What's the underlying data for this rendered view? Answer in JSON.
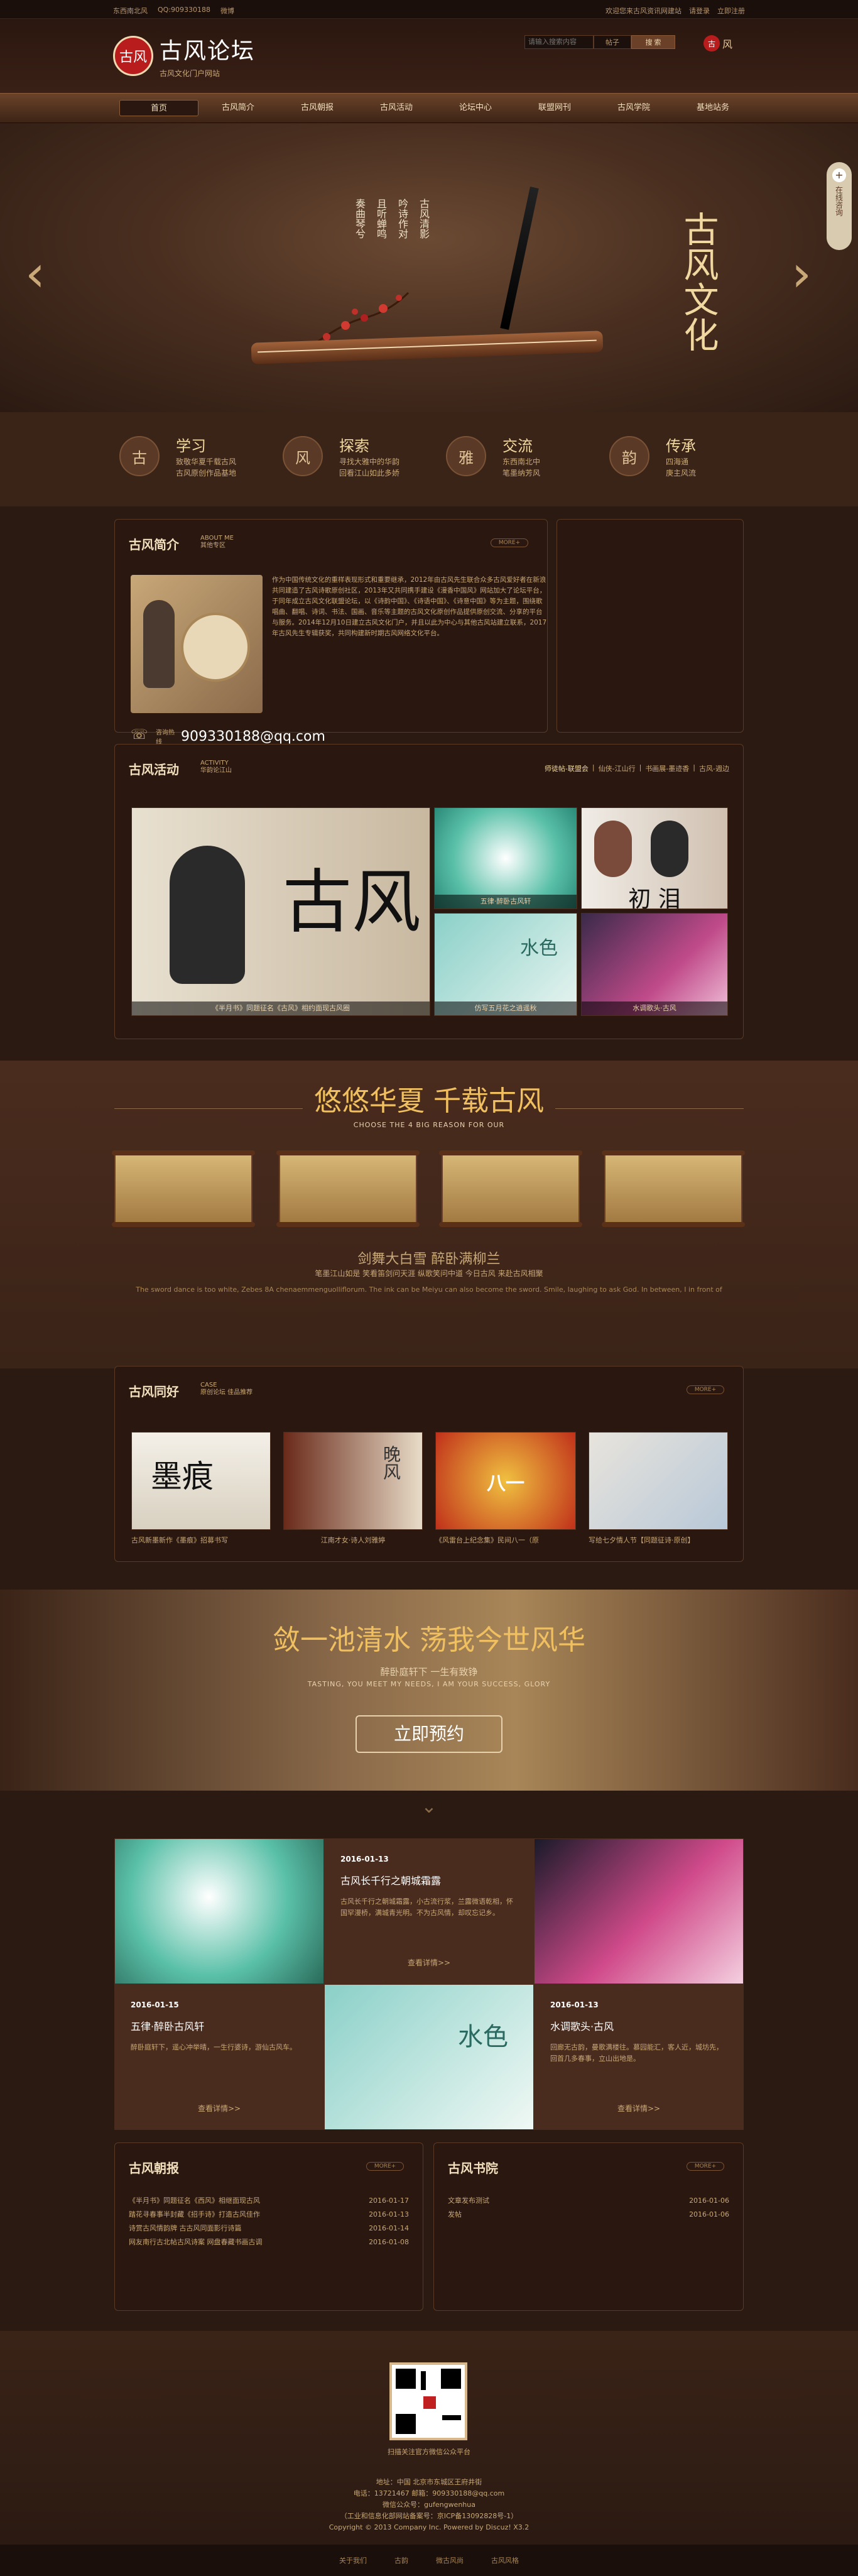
{
  "topbar": {
    "site": "东西南北风",
    "qq": "QQ:909330188",
    "weibo": "微博",
    "welcome": "欢迎您来古风资讯网建站",
    "login": "请登录",
    "register": "立即注册"
  },
  "header": {
    "logo_seal": "古风",
    "title": "古风论坛",
    "subtitle": "古风文化门户网站",
    "search_placeholder": "请输入搜索内容",
    "keyword": "帖子",
    "search_button": "搜 索",
    "seal_badge": "古",
    "seal_text": "风"
  },
  "nav": [
    "首页",
    "古风简介",
    "古风朝报",
    "古风活动",
    "论坛中心",
    "联盟网刊",
    "古风学院",
    "基地站务"
  ],
  "banner": {
    "poem": [
      "奏曲琴兮",
      "且听蝉鸣",
      "吟诗作对",
      "古风清影"
    ],
    "big_title": "古风文化",
    "consult": "在线咨询"
  },
  "features": [
    {
      "icon": "古",
      "title": "学习",
      "line1": "致敬华夏千载古风",
      "line2": "古风原创作品基地"
    },
    {
      "icon": "风",
      "title": "探索",
      "line1": "寻找大雅中的华韵",
      "line2": "回看江山如此多娇"
    },
    {
      "icon": "雅",
      "title": "交流",
      "line1": "东西南北中",
      "line2": "笔墨纳芳风"
    },
    {
      "icon": "韵",
      "title": "传承",
      "line1": "四海通",
      "line2": "庚主风流"
    }
  ],
  "about": {
    "title": "古风简介",
    "sub_en": "ABOUT ME",
    "sub_cn": "其他专区",
    "more": "MORE+",
    "text": "作为中国传统文化的重样表现形式和重要继承，2012年由古风先生联合众多古风爱好者在新浪共同建造了古风诗歌原创社区，2013年又共同携手建设《漫香中国风》网站加大了论坛平台，于同年成立古风文化联盟论坛，以《诗韵中国》、《诗语中国》、《诗意中国》等为主题，围绕歌唱曲、翻唱、诗词、书法、国画、音乐等主题的古风文化原创作品提供原创交流、分享的平台与服务。2014年12月10日建立古风文化门户，并且以此为中心与其他古风站建立联系，2017年古风先生专辑获奖，共同构建新时期古风网络文化平台。",
    "phone_label": "咨询热线",
    "phone": "909330188@qq.com"
  },
  "activity": {
    "title": "古风活动",
    "sub_en": "ACTIVITY",
    "sub_cn": "华韵论江山",
    "tabs": [
      "师徒帖-联盟会",
      "仙侠-江山行",
      "书画展-墨迹香",
      "古风-週边"
    ],
    "big_caption": "《半月书》同题征名《古风》相约面现古风圈",
    "captions": [
      "五律·醉卧古风轩",
      "",
      "仿写五月花之逍遥秋",
      "水调歌头·古风"
    ]
  },
  "slogan": {
    "title": "悠悠华夏 千载古风",
    "sub_en": "CHOOSE THE 4 BIG REASON FOR OUR",
    "sub1": "剑舞大白雪 醉卧满柳兰",
    "sub2": "笔墨江山如是 笑看笛剑问天涯 纵歌笑问中道 今日古风 来赴古风相聚",
    "sub3": "The sword dance is too white, Zebes 8A chenaemmenguolliflorum. The ink can be Meiyu can also become the sword. Smile, laughing to ask God. In between, I in front of"
  },
  "hobby": {
    "title": "古风同好",
    "sub_en": "CASE",
    "sub_cn": "原创论坛 佳品推荐",
    "more": "MORE+",
    "items": [
      "古风新墨新作《墨痕》招募书写",
      "江南才女·诗人刘雅婷",
      "《风雷台上纪念集》民间八一（原",
      "写给七夕情人节【同题征诗·原创】"
    ]
  },
  "reserve": {
    "title": "敛一池清水 荡我今世风华",
    "sub1": "醉卧庭轩下 一生有致铮",
    "sub2": "TASTING, YOU MEET MY NEEDS, I AM YOUR SUCCESS, GLORY",
    "button": "立即预约"
  },
  "news_cards": [
    {
      "date": "2016-01-13",
      "title": "古风长千行之朝城霜露",
      "text": "古风长千行之朝城霜露，小古流行浆，兰露微语乾相，怀国罕漫桥，满城青光明。不为古风情，却叹忘记乡。",
      "more": "查看详情>>"
    },
    {
      "date": "2016-01-15",
      "title": "五律·醉卧古风轩",
      "text": "醉卧庭轩下，遥心冲举晴，一生行婆诗，游仙古风车。",
      "more": "查看详情>>"
    },
    {
      "date": "2016-01-13",
      "title": "水调歌头·古风",
      "text": "回廊无古韵，曼歌满楼往。慕园能汇，客人近，城坊先，回首几多春事，立山出地是。",
      "more": "查看详情>>"
    }
  ],
  "morning": {
    "title": "古风朝报",
    "more": "MORE+",
    "rows": [
      {
        "t": "《半月书》同题征名《西风》相继面现古风",
        "d": "2016-01-17"
      },
      {
        "t": "踏花寻春事半封藏《招手诗》打造古风佳作",
        "d": "2016-01-13"
      },
      {
        "t": "诗赏古风情韵牌 古古风同面影行诗篇",
        "d": "2016-01-14"
      },
      {
        "t": "网友南行古北帖古风诗案 网盘春藏书画古调",
        "d": "2016-01-08"
      }
    ]
  },
  "academy": {
    "title": "古风书院",
    "more": "MORE+",
    "rows": [
      {
        "t": "文章发布测试",
        "d": "2016-01-06"
      },
      {
        "t": "发帖",
        "d": "2016-01-06"
      }
    ]
  },
  "footer": {
    "qr_caption": "扫描关注官方微信公众平台",
    "addr": "地址：中国 北京市东城区王府井街",
    "contact": "电话：13721467  邮箱：909330188@qq.com",
    "wechat": "微信公众号：gufengwenhua",
    "icp": "（工业和信息化部网站备案号：京ICP备13092828号-1）",
    "copyright": "Copyright © 2013 Company Inc. Powered by Discuz! X3.2",
    "links": [
      "关于我们",
      "古韵",
      "微古风尚",
      "古风风格"
    ]
  }
}
